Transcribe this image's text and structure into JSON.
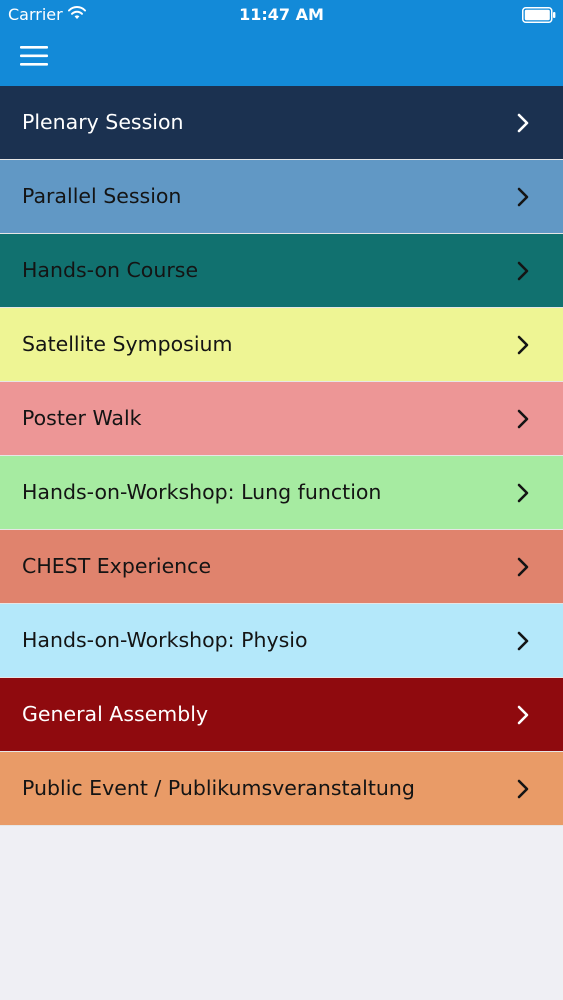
{
  "status_bar": {
    "carrier": "Carrier",
    "time": "11:47 AM",
    "icons": [
      "wifi-icon",
      "battery-icon"
    ]
  },
  "header": {
    "background": "#138ad8",
    "menu_icon": "hamburger-menu-icon"
  },
  "menu": {
    "items": [
      {
        "label": "Plenary Session",
        "bg": "#1b3150",
        "fg": "#ffffff",
        "chevron": "#ffffff"
      },
      {
        "label": "Parallel Session",
        "bg": "#6198c5",
        "fg": "#141414",
        "chevron": "#141414"
      },
      {
        "label": "Hands-on Course",
        "bg": "#11716f",
        "fg": "#141414",
        "chevron": "#141414"
      },
      {
        "label": "Satellite Symposium",
        "bg": "#eef594",
        "fg": "#141414",
        "chevron": "#141414"
      },
      {
        "label": "Poster Walk",
        "bg": "#ed9696",
        "fg": "#141414",
        "chevron": "#141414"
      },
      {
        "label": "Hands-on-Workshop: Lung function",
        "bg": "#a6eba1",
        "fg": "#141414",
        "chevron": "#141414"
      },
      {
        "label": "CHEST Experience",
        "bg": "#e0836d",
        "fg": "#141414",
        "chevron": "#141414"
      },
      {
        "label": "Hands-on-Workshop: Physio",
        "bg": "#b4e8fa",
        "fg": "#141414",
        "chevron": "#141414"
      },
      {
        "label": "General Assembly",
        "bg": "#8f0a0e",
        "fg": "#ffffff",
        "chevron": "#ffffff"
      },
      {
        "label": "Public Event / Publikumsveranstaltung",
        "bg": "#e99b67",
        "fg": "#141414",
        "chevron": "#141414"
      }
    ]
  },
  "page_background": "#efeff4"
}
